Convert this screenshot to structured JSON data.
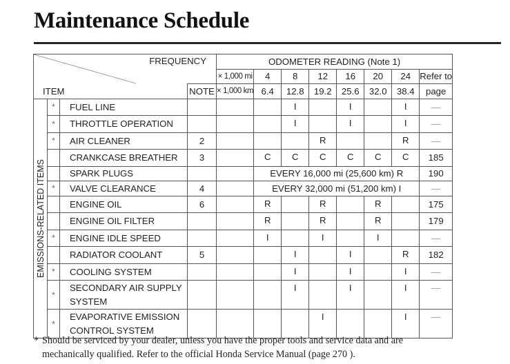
{
  "title": "Maintenance Schedule",
  "table": {
    "frequency_label": "FREQUENCY",
    "item_label": "ITEM",
    "note_label": "NOTE",
    "odometer_label": "ODOMETER READING (Note 1)",
    "unit_mi": "× 1,000 mi",
    "unit_km": "× 1,000 km",
    "refer_label_1": "Refer to",
    "refer_label_2": "page",
    "miles": [
      "4",
      "8",
      "12",
      "16",
      "20",
      "24"
    ],
    "km": [
      "6.4",
      "12.8",
      "19.2",
      "25.6",
      "32.0",
      "38.4"
    ],
    "group_label": "EMISSIONS-RELATED ITEMS",
    "rows": [
      {
        "star": "*",
        "name": "FUEL LINE",
        "note": "",
        "cells": [
          "",
          "I",
          "",
          "I",
          "",
          "I"
        ],
        "page": "—"
      },
      {
        "star": "*",
        "name": "THROTTLE OPERATION",
        "note": "",
        "cells": [
          "",
          "I",
          "",
          "I",
          "",
          "I"
        ],
        "page": "—"
      },
      {
        "star": "*",
        "name": "AIR CLEANER",
        "note": "2",
        "cells": [
          "",
          "",
          "R",
          "",
          "",
          "R"
        ],
        "page": "—"
      },
      {
        "star": "",
        "name": "CRANKCASE BREATHER",
        "note": "3",
        "cells": [
          "C",
          "C",
          "C",
          "C",
          "C",
          "C"
        ],
        "page": "185"
      },
      {
        "star": "",
        "name": "SPARK PLUGS",
        "note": "",
        "span": "EVERY 16,000 mi (25,600 km) R",
        "page": "190"
      },
      {
        "star": "*",
        "name": "VALVE CLEARANCE",
        "note": "4",
        "span": "EVERY 32,000 mi (51,200 km) I",
        "page": "—"
      },
      {
        "star": "",
        "name": "ENGINE OIL",
        "note": "6",
        "cells": [
          "R",
          "",
          "R",
          "",
          "R",
          ""
        ],
        "page": "175"
      },
      {
        "star": "",
        "name": "ENGINE OIL FILTER",
        "note": "",
        "cells": [
          "R",
          "",
          "R",
          "",
          "R",
          ""
        ],
        "page": "179"
      },
      {
        "star": "*",
        "name": "ENGINE IDLE SPEED",
        "note": "",
        "cells": [
          "I",
          "",
          "I",
          "",
          "I",
          ""
        ],
        "page": "—"
      },
      {
        "star": "",
        "name": "RADIATOR COOLANT",
        "note": "5",
        "cells": [
          "",
          "I",
          "",
          "I",
          "",
          "R"
        ],
        "page": "182"
      },
      {
        "star": "*",
        "name": "COOLING SYSTEM",
        "note": "",
        "cells": [
          "",
          "I",
          "",
          "I",
          "",
          "I"
        ],
        "page": "—"
      },
      {
        "star": "*",
        "name_1": "SECONDARY AIR SUPPLY",
        "name_2": "SYSTEM",
        "note": "",
        "cells": [
          "",
          "I",
          "",
          "I",
          "",
          "I"
        ],
        "page": "—"
      },
      {
        "star": "*",
        "name_1": "EVAPORATIVE EMISSION",
        "name_2": "CONTROL SYSTEM",
        "note": "",
        "cells": [
          "",
          "",
          "I",
          "",
          "",
          "I"
        ],
        "page": "—"
      }
    ]
  },
  "footnote": {
    "asterisk": "*",
    "line1": "Should be serviced by your dealer, unless you have the proper tools and service data and are",
    "line2": "mechanically qualified. Refer to the official Honda Service Manual (page 270 )."
  }
}
